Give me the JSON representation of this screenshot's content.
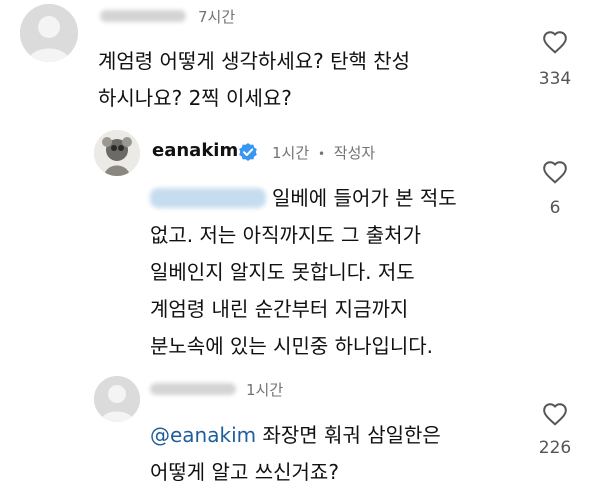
{
  "comments": [
    {
      "time": "7시간",
      "lines": [
        "계엄령 어떻게 생각하세요? 탄핵 찬성",
        "하시나요? 2찍 이세요?"
      ],
      "likes": "334",
      "icon": "heart-outline"
    },
    {
      "username": "eanakim",
      "verified_icon": "verified-badge",
      "time": "1시간",
      "separator": "•",
      "author_label": "작성자",
      "line1_tail": "일베에 들어가 본 적도",
      "lines": [
        "없고. 저는 아직까지도 그 출처가",
        "일베인지 알지도 못합니다. 저도",
        "계엄령 내린 순간부터 지금까지",
        "분노속에 있는 시민중 하나입니다."
      ],
      "likes": "6",
      "icon": "heart-outline"
    },
    {
      "time": "1시간",
      "mention": "@eanakim",
      "line1_tail": " 좌장면 훠궈 삼일한은",
      "lines": [
        "어떻게 알고 쓰신거죠?"
      ],
      "likes": "226",
      "icon": "heart-outline"
    }
  ],
  "colors": {
    "mention": "#1f5d9c",
    "verified": "#3897f0",
    "secondary_text": "#737373"
  }
}
